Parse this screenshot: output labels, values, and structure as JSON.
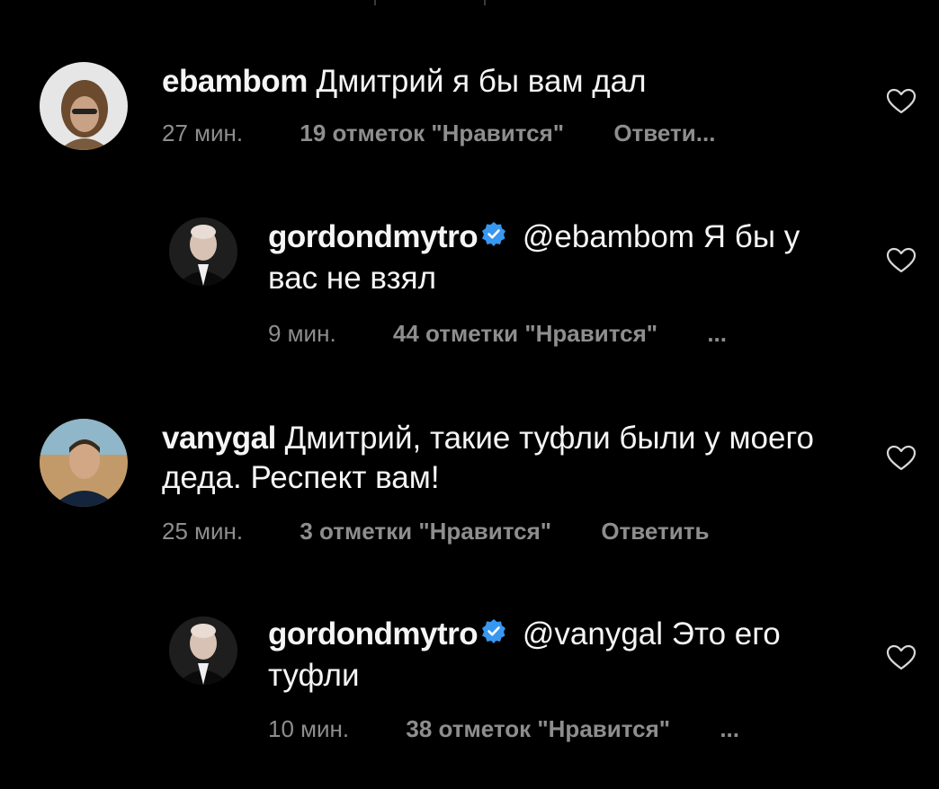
{
  "comments": [
    {
      "username": "ebambom",
      "text": "Дмитрий я бы вам дал",
      "time": "27 мин.",
      "likes": "19 отметок \"Нравится\"",
      "reply": "Ответи..."
    },
    {
      "username": "gordondmytro",
      "verified": true,
      "mention": "@ebambom",
      "text": "Я бы у вас не взял",
      "time": "9 мин.",
      "likes": "44 отметки \"Нравится\"",
      "reply": "..."
    },
    {
      "username": "vanygal",
      "text": "Дмитрий, такие туфли были у моего деда. Респект вам!",
      "time": "25 мин.",
      "likes": "3 отметки \"Нравится\"",
      "reply": "Ответить"
    },
    {
      "username": "gordondmytro",
      "verified": true,
      "mention": "@vanygal",
      "text": "Это его туфли",
      "time": "10 мин.",
      "likes": "38 отметок \"Нравится\"",
      "reply": "..."
    }
  ],
  "icons": {
    "like": "heart-outline-icon",
    "verified": "verified-badge-icon"
  },
  "colors": {
    "background": "#000000",
    "text": "#f5f5f5",
    "meta": "#8e8e8e",
    "verified": "#3897f0"
  }
}
